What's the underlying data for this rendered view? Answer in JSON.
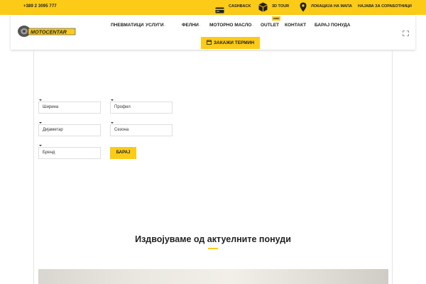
{
  "topbar": {
    "phone": "+389 2 3095 777",
    "links": [
      {
        "label": "CASHBACK",
        "icon": "card-icon"
      },
      {
        "label": "3D TOUR",
        "icon": "cube-icon"
      },
      {
        "label": "ЛОКАЦИЈА НА МАПА",
        "icon": "map-pin-icon"
      },
      {
        "label": "НАЈАВА ЗА СОРАБОТНИЦИ"
      }
    ]
  },
  "header": {
    "logo_text": "MOTOCENTAR",
    "nav": [
      {
        "label": "ПНЕВМАТИЦИ"
      },
      {
        "label": "УСЛУГИ",
        "caret": "›"
      },
      {
        "label": "ФЕЛНИ",
        "caret": "›"
      },
      {
        "label": "МОТОРНО МАСЛО",
        "caret": "›"
      },
      {
        "label": "OUTLET",
        "badge": "ново"
      },
      {
        "label": "КОНТАКТ"
      },
      {
        "label": "БАРАЈ ПОНУДА"
      }
    ],
    "cta_label": "ЗАКАЖИ ТЕРМИН"
  },
  "search_form": {
    "fields": [
      {
        "placeholder": "Ширина"
      },
      {
        "placeholder": "Профил"
      },
      {
        "placeholder": "Дијаметар"
      },
      {
        "placeholder": "Сезона"
      },
      {
        "placeholder": "Бренд"
      }
    ],
    "submit_label": "БАРАЈ"
  },
  "offers": {
    "title": "Издвојуваме од актуелните понуди"
  },
  "colors": {
    "accent": "#fbcb17",
    "text": "#222222"
  }
}
